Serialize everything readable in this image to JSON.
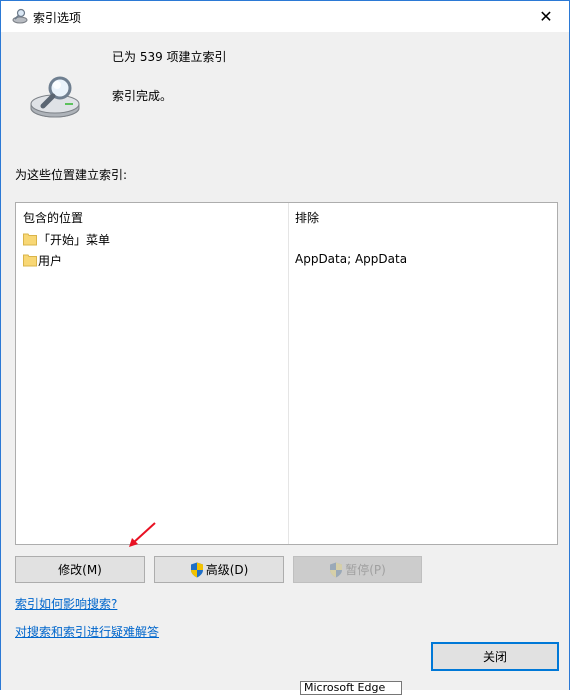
{
  "window": {
    "title": "索引选项",
    "close_glyph": "✕"
  },
  "status": {
    "count_text": "已为 539 项建立索引",
    "complete_text": "索引完成。"
  },
  "section_label": "为这些位置建立索引:",
  "table": {
    "headers": {
      "location": "包含的位置",
      "exclude": "排除"
    },
    "rows": [
      {
        "location": "「开始」菜单",
        "exclude": ""
      },
      {
        "location": "用户",
        "exclude": "AppData; AppData"
      }
    ]
  },
  "buttons": {
    "modify": "修改(M)",
    "advanced": "高级(D)",
    "pause": "暂停(P)",
    "close": "关闭"
  },
  "links": {
    "how_affects": "索引如何影响搜索?",
    "troubleshoot": "对搜索和索引进行疑难解答"
  },
  "tooltip": "Microsoft Edge",
  "colors": {
    "accent": "#0078d7",
    "link": "#0066cc",
    "arrow": "#e81123",
    "folder": "#f8d775"
  }
}
